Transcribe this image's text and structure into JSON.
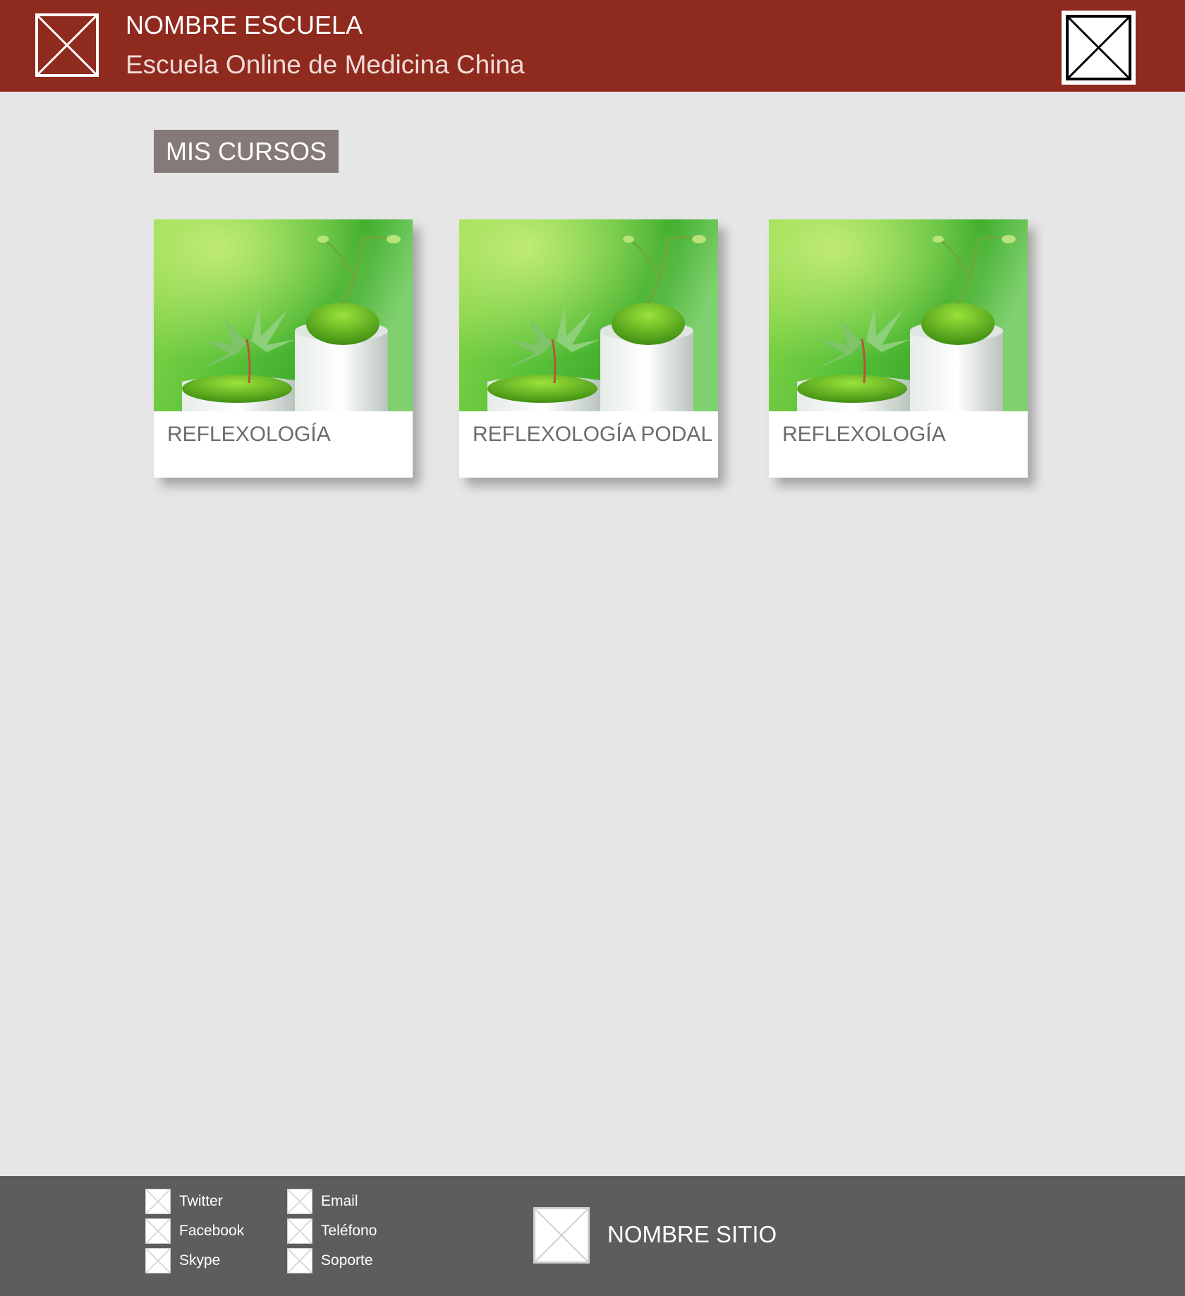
{
  "header": {
    "school_name": "NOMBRE ESCUELA",
    "school_subtitle": "Escuela Online de Medicina China",
    "logo_icon": "image-placeholder-icon",
    "user_icon": "image-placeholder-icon"
  },
  "main": {
    "section_title": "MIS CURSOS",
    "courses": [
      {
        "title": "REFLEXOLOGÍA",
        "image": "plant-moss-photo"
      },
      {
        "title": "REFLEXOLOGÍA PODAL",
        "image": "plant-moss-photo"
      },
      {
        "title": "REFLEXOLOGÍA",
        "image": "plant-moss-photo"
      }
    ]
  },
  "footer": {
    "social": [
      {
        "label": "Twitter",
        "icon": "image-placeholder-icon"
      },
      {
        "label": "Facebook",
        "icon": "image-placeholder-icon"
      },
      {
        "label": "Skype",
        "icon": "image-placeholder-icon"
      }
    ],
    "contact": [
      {
        "label": "Email",
        "icon": "image-placeholder-icon"
      },
      {
        "label": "Teléfono",
        "icon": "image-placeholder-icon"
      },
      {
        "label": "Soporte",
        "icon": "image-placeholder-icon"
      }
    ],
    "site_name": "NOMBRE SITIO",
    "site_logo_icon": "image-placeholder-icon"
  },
  "colors": {
    "header_bg": "#8f2a1f",
    "page_bg": "#e6e6e6",
    "section_label_bg": "#857a78",
    "footer_bg": "#5d5d5d",
    "card_bg": "#ffffff",
    "card_title": "#6b6b6b"
  }
}
